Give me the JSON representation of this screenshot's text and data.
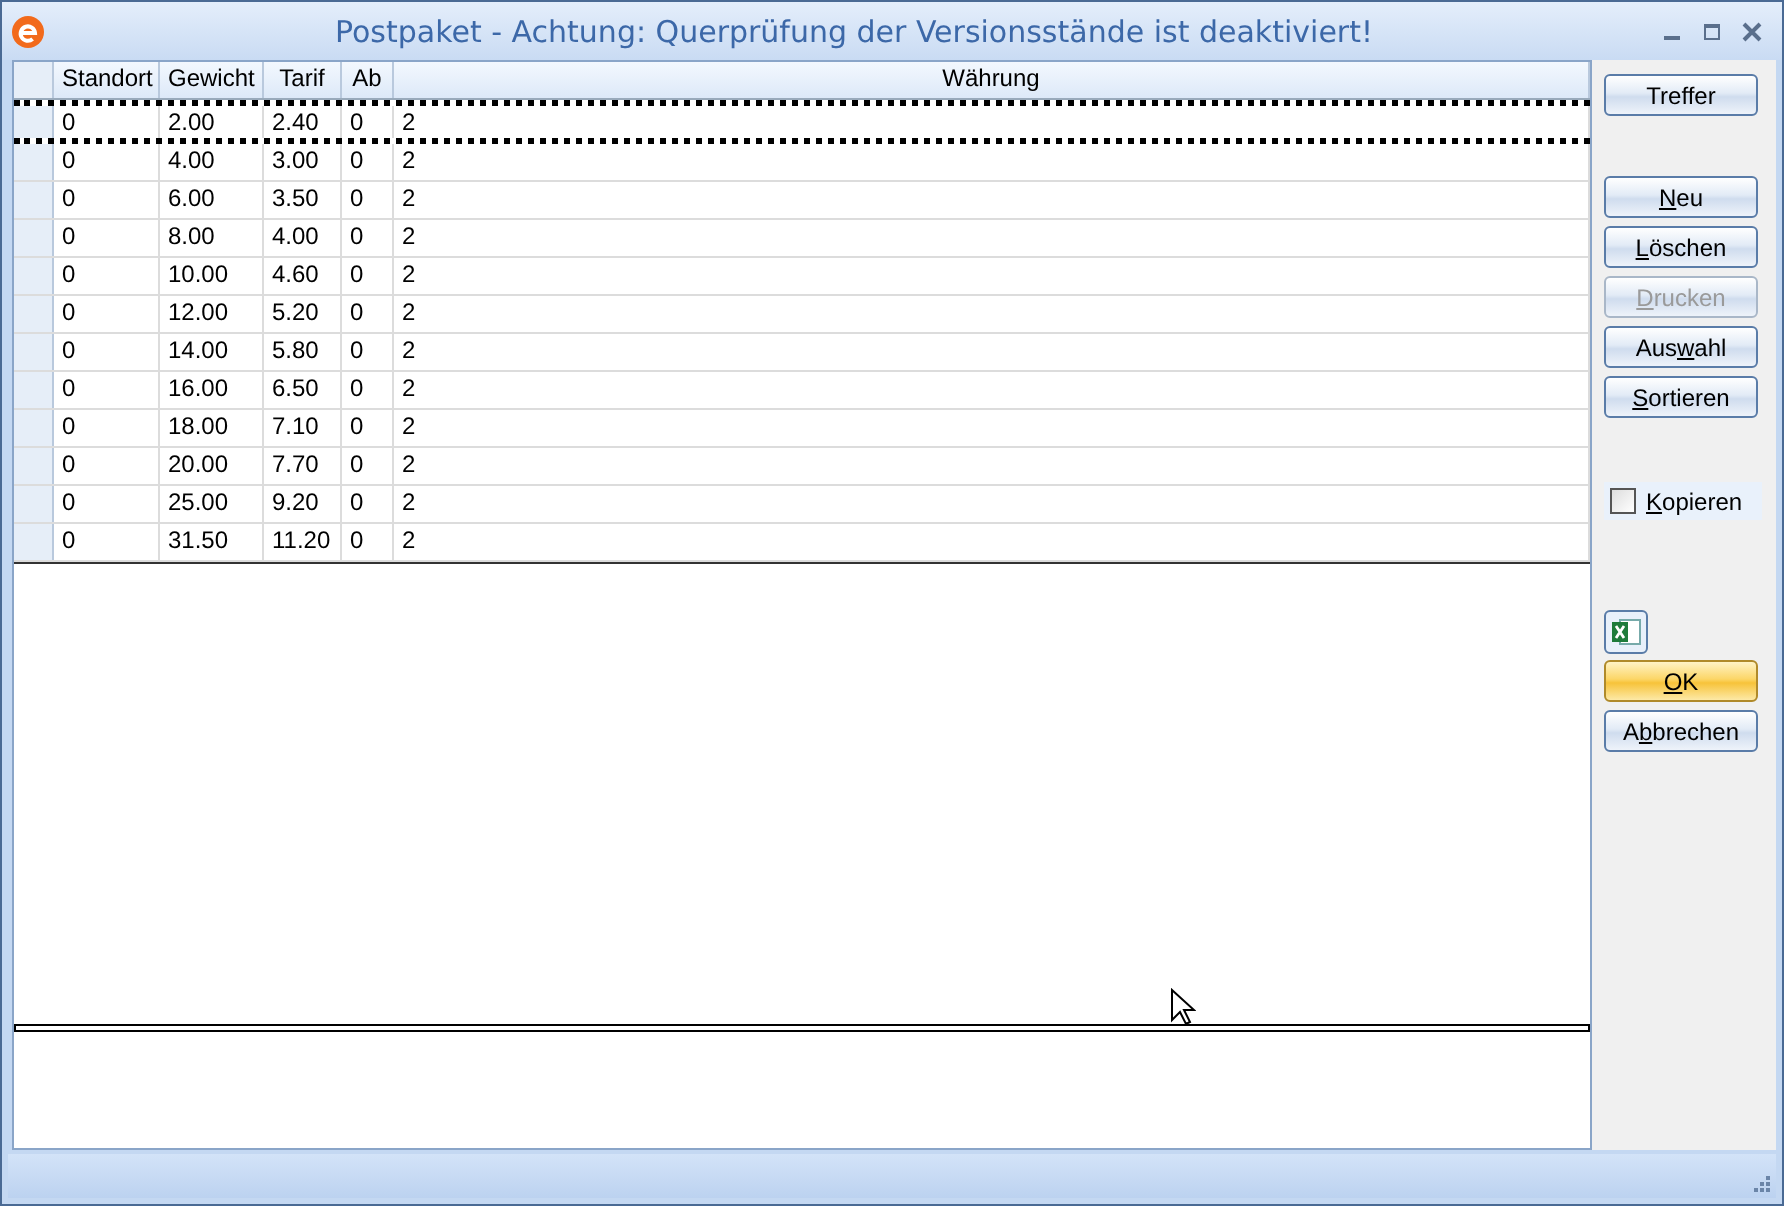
{
  "window": {
    "title": "Postpaket - Achtung: Querprüfung der Versionsstände ist deaktiviert!"
  },
  "table": {
    "columns": [
      "Standort",
      "Gewicht",
      "Tarif",
      "Ab",
      "Währung"
    ],
    "rows": [
      {
        "cells": [
          "0",
          "2.00",
          "2.40",
          "0",
          "2"
        ],
        "selected": true
      },
      {
        "cells": [
          "0",
          "4.00",
          "3.00",
          "0",
          "2"
        ],
        "selected": false
      },
      {
        "cells": [
          "0",
          "6.00",
          "3.50",
          "0",
          "2"
        ],
        "selected": false
      },
      {
        "cells": [
          "0",
          "8.00",
          "4.00",
          "0",
          "2"
        ],
        "selected": false
      },
      {
        "cells": [
          "0",
          "10.00",
          "4.60",
          "0",
          "2"
        ],
        "selected": false
      },
      {
        "cells": [
          "0",
          "12.00",
          "5.20",
          "0",
          "2"
        ],
        "selected": false
      },
      {
        "cells": [
          "0",
          "14.00",
          "5.80",
          "0",
          "2"
        ],
        "selected": false
      },
      {
        "cells": [
          "0",
          "16.00",
          "6.50",
          "0",
          "2"
        ],
        "selected": false
      },
      {
        "cells": [
          "0",
          "18.00",
          "7.10",
          "0",
          "2"
        ],
        "selected": false
      },
      {
        "cells": [
          "0",
          "20.00",
          "7.70",
          "0",
          "2"
        ],
        "selected": false
      },
      {
        "cells": [
          "0",
          "25.00",
          "9.20",
          "0",
          "2"
        ],
        "selected": false
      },
      {
        "cells": [
          "0",
          "31.50",
          "11.20",
          "0",
          "2"
        ],
        "selected": false
      }
    ]
  },
  "side_panel": [
    {
      "kind": "button",
      "label": "Treffer",
      "disabled": false
    },
    {
      "kind": "gap"
    },
    {
      "kind": "button",
      "label_parts": [
        {
          "text": "N",
          "underlined": true
        },
        {
          "text": "eu",
          "underlined": false
        }
      ],
      "disabled": false
    },
    {
      "kind": "button",
      "label_parts": [
        {
          "text": "L",
          "underlined": true
        },
        {
          "text": "öschen",
          "underlined": false
        }
      ],
      "disabled": false
    },
    {
      "kind": "button",
      "label_parts": [
        {
          "text": "D",
          "underlined": true
        },
        {
          "text": "rucken",
          "underlined": false
        }
      ],
      "disabled": true
    },
    {
      "kind": "button",
      "label_parts": [
        {
          "text": "Aus",
          "underlined": false
        },
        {
          "text": "w",
          "underlined": true
        },
        {
          "text": "ahl",
          "underlined": false
        }
      ],
      "disabled": false
    },
    {
      "kind": "button",
      "label_parts": [
        {
          "text": "S",
          "underlined": true
        },
        {
          "text": "ortieren",
          "underlined": false
        }
      ],
      "disabled": false
    },
    {
      "kind": "checkbox",
      "label_parts": [
        {
          "text": "K",
          "underlined": true
        },
        {
          "text": "opieren",
          "underlined": false
        }
      ],
      "checked": false
    },
    {
      "kind": "excel"
    },
    {
      "kind": "default-button",
      "label_parts": [
        {
          "text": "O",
          "underlined": true
        },
        {
          "text": "K",
          "underlined": false
        }
      ],
      "disabled": false
    },
    {
      "kind": "button",
      "label_parts": [
        {
          "text": "A",
          "underlined": false
        },
        {
          "text": "b",
          "underlined": true
        },
        {
          "text": "brechen",
          "underlined": false
        }
      ],
      "disabled": false
    }
  ]
}
